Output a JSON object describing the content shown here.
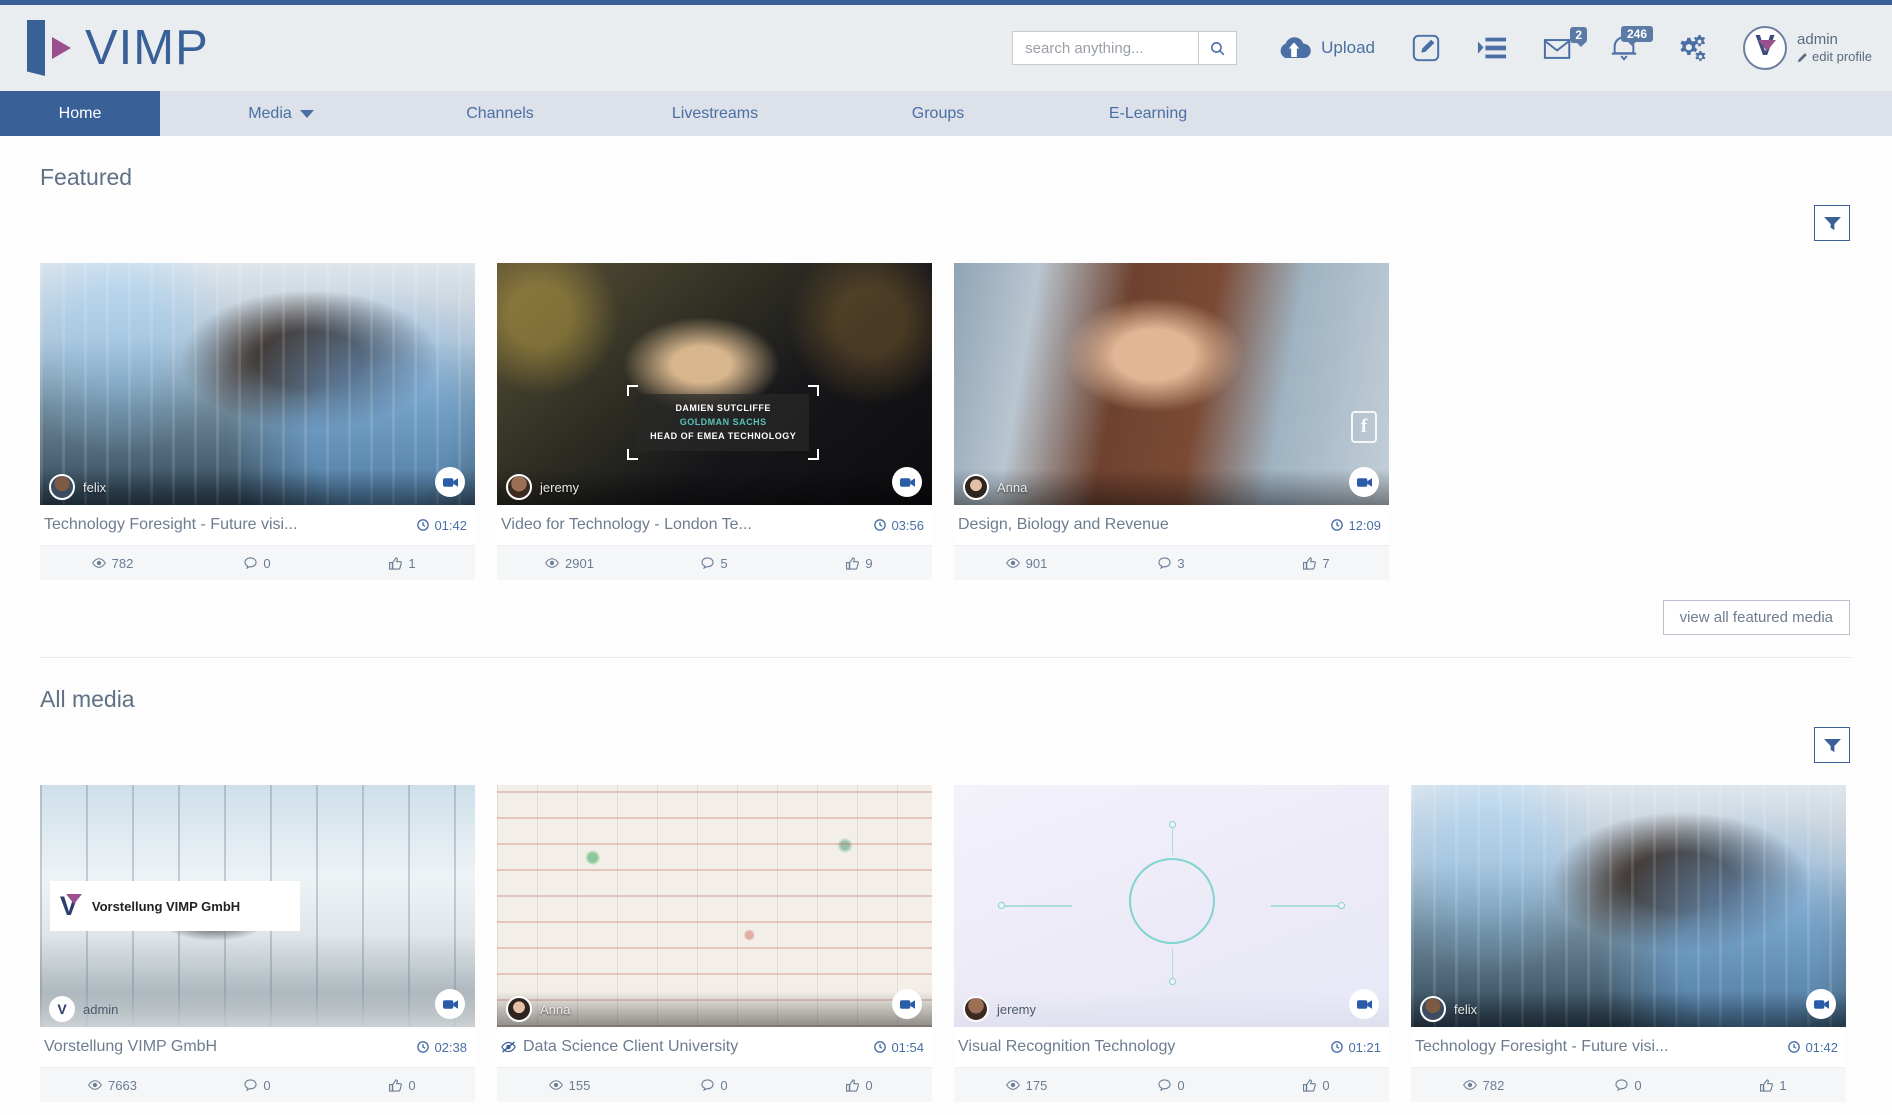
{
  "brand": {
    "name": "VIMP",
    "accent": "#3a6098",
    "accent2": "#9a4f8f"
  },
  "header": {
    "search": {
      "placeholder": "search anything...",
      "value": ""
    },
    "upload_label": "Upload",
    "messages_badge": "2",
    "notifications_badge": "246",
    "user": {
      "name": "admin",
      "edit_label": "edit profile",
      "avatar_letter": "V"
    }
  },
  "nav": {
    "items": [
      {
        "label": "Home",
        "active": true,
        "caret": false
      },
      {
        "label": "Media",
        "active": false,
        "caret": true
      },
      {
        "label": "Channels",
        "active": false,
        "caret": false
      },
      {
        "label": "Livestreams",
        "active": false,
        "caret": false
      },
      {
        "label": "Groups",
        "active": false,
        "caret": false
      },
      {
        "label": "E-Learning",
        "active": false,
        "caret": false
      }
    ]
  },
  "sections": [
    {
      "title": "Featured",
      "view_all_label": "view all featured media",
      "cards": [
        {
          "title": "Technology Foresight - Future visi...",
          "duration": "01:42",
          "uploader": "felix",
          "views": "782",
          "comments": "0",
          "likes": "1",
          "private": false,
          "facebook": false
        },
        {
          "title": "Video for Technology - London Te...",
          "duration": "03:56",
          "uploader": "jeremy",
          "views": "2901",
          "comments": "5",
          "likes": "9",
          "private": false,
          "facebook": false,
          "lower_third": {
            "name": "DAMIEN SUTCLIFFE",
            "org": "GOLDMAN SACHS",
            "role": "HEAD OF EMEA TECHNOLOGY"
          }
        },
        {
          "title": "Design, Biology and Revenue",
          "duration": "12:09",
          "uploader": "Anna",
          "views": "901",
          "comments": "3",
          "likes": "7",
          "private": false,
          "facebook": true
        }
      ]
    },
    {
      "title": "All media",
      "cards": [
        {
          "title": "Vorstellung VIMP GmbH",
          "duration": "02:38",
          "uploader": "admin",
          "views": "7663",
          "comments": "0",
          "likes": "0",
          "private": false,
          "facebook": false,
          "tile_label": "Vorstellung VIMP GmbH"
        },
        {
          "title": "Data Science Client University",
          "duration": "01:54",
          "uploader": "Anna",
          "views": "155",
          "comments": "0",
          "likes": "0",
          "private": true,
          "facebook": false
        },
        {
          "title": "Visual Recognition Technology",
          "duration": "01:21",
          "uploader": "jeremy",
          "views": "175",
          "comments": "0",
          "likes": "0",
          "private": false,
          "facebook": false
        },
        {
          "title": "Technology Foresight - Future visi...",
          "duration": "01:42",
          "uploader": "felix",
          "views": "782",
          "comments": "0",
          "likes": "1",
          "private": false,
          "facebook": false
        }
      ]
    }
  ]
}
